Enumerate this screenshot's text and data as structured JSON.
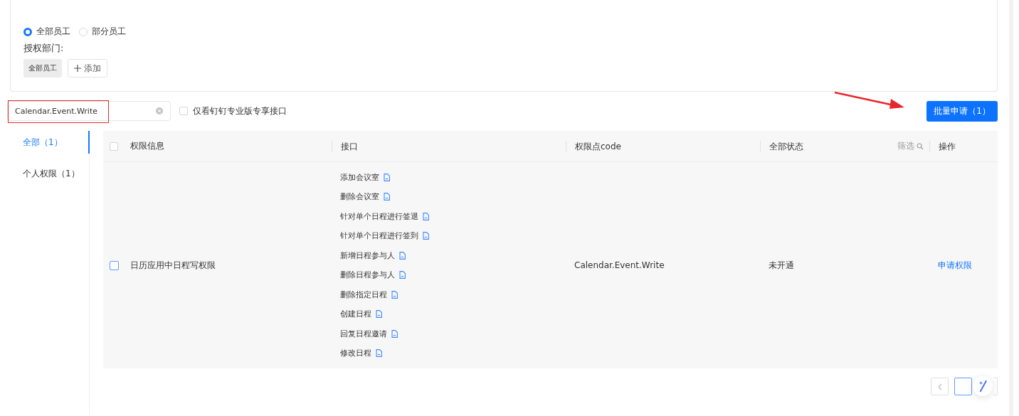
{
  "scope": {
    "radios": [
      {
        "label": "全部员工",
        "selected": true
      },
      {
        "label": "部分员工",
        "selected": false
      }
    ],
    "dept_label": "授权部门:",
    "dept_tags": [
      "全部员工"
    ],
    "add_button": "添加"
  },
  "search": {
    "value": "Calendar.Event.Write"
  },
  "pro_only": {
    "label": "仅看钉钉专业版专享接口",
    "checked": false
  },
  "batch_button": "批量申请（1）",
  "categories": [
    {
      "label": "全部（1）",
      "selected": true
    },
    {
      "label": "个人权限（1）",
      "selected": false
    }
  ],
  "table": {
    "columns": [
      "权限信息",
      "接口",
      "权限点code",
      "全部状态",
      "操作"
    ],
    "filter_label": "筛选",
    "all_checked": false,
    "rows": [
      {
        "checked": false,
        "name": "日历应用中日程写权限",
        "apis": [
          "添加会议室",
          "删除会议室",
          "针对单个日程进行签退",
          "针对单个日程进行签到",
          "新增日程参与人",
          "删除日程参与人",
          "删除指定日程",
          "创建日程",
          "回复日程邀请",
          "修改日程"
        ],
        "code": "Calendar.Event.Write",
        "status": "未开通",
        "action": "申请权限"
      }
    ]
  },
  "pagination": {
    "pages": [
      {
        "selected": true
      }
    ]
  }
}
